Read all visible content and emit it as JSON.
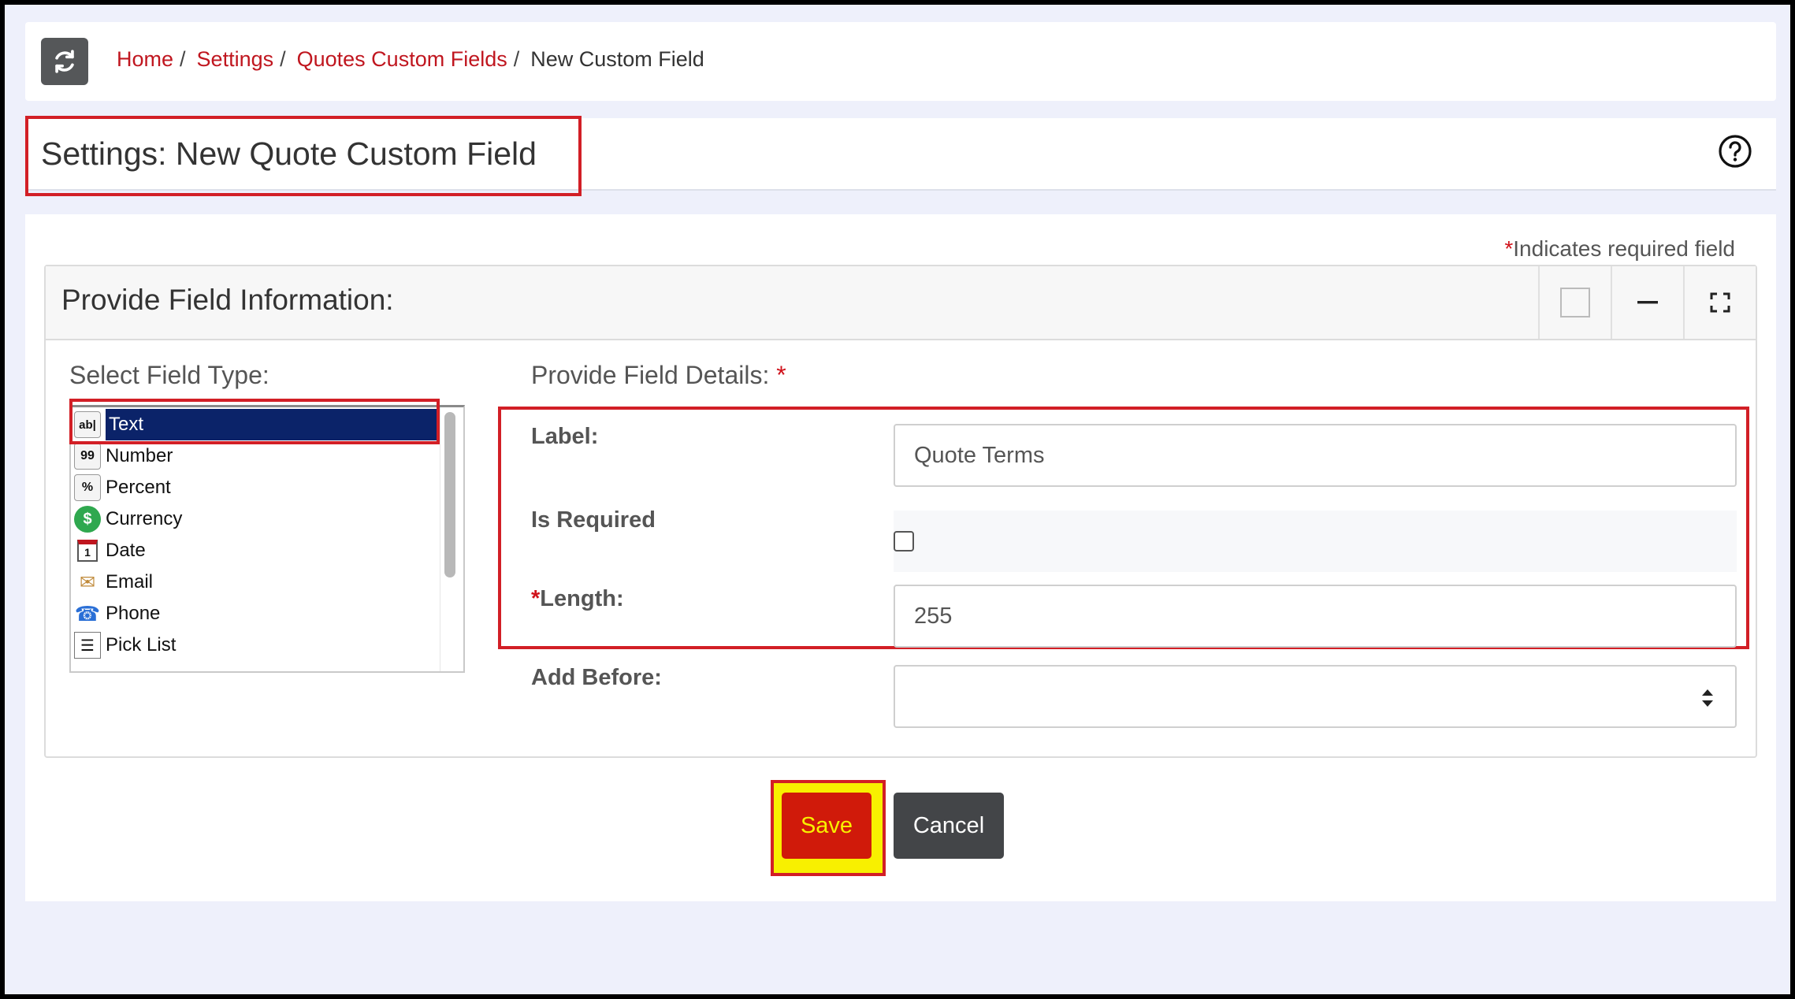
{
  "breadcrumb": {
    "items": [
      "Home",
      "Settings",
      "Quotes Custom Fields"
    ],
    "separator": "/",
    "current": "New Custom Field"
  },
  "header": {
    "title": "Settings: New Quote Custom Field",
    "help_icon": "question-circle-icon"
  },
  "form": {
    "required_star": "*",
    "required_note": "Indicates required field",
    "panel_title": "Provide Field Information:",
    "field_type_label": "Select Field Type:",
    "field_types": [
      {
        "label": "Text",
        "icon": "text-field-icon",
        "glyph": "ab|"
      },
      {
        "label": "Number",
        "icon": "number-icon",
        "glyph": "99"
      },
      {
        "label": "Percent",
        "icon": "percent-icon",
        "glyph": "%"
      },
      {
        "label": "Currency",
        "icon": "currency-icon",
        "glyph": "$"
      },
      {
        "label": "Date",
        "icon": "calendar-icon",
        "glyph": "1"
      },
      {
        "label": "Email",
        "icon": "email-icon",
        "glyph": "✉"
      },
      {
        "label": "Phone",
        "icon": "phone-icon",
        "glyph": "☎"
      },
      {
        "label": "Pick List",
        "icon": "pick-list-icon",
        "glyph": "☰"
      }
    ],
    "selected_type": "Text",
    "details_label": "Provide Field Details:",
    "label_field": {
      "label": "Label:",
      "value": "Quote Terms"
    },
    "is_required": {
      "label": "Is Required",
      "checked": false
    },
    "length_field": {
      "label": "Length:",
      "value": "255"
    },
    "add_before": {
      "label": "Add Before:",
      "value": ""
    }
  },
  "buttons": {
    "save": "Save",
    "cancel": "Cancel"
  },
  "colors": {
    "accent_red": "#c0161f",
    "highlight_red": "#d21f26",
    "highlight_yellow": "#f8f000",
    "selected_blue": "#0b2369",
    "save_bg": "#d01a0a",
    "cancel_bg": "#434548"
  }
}
